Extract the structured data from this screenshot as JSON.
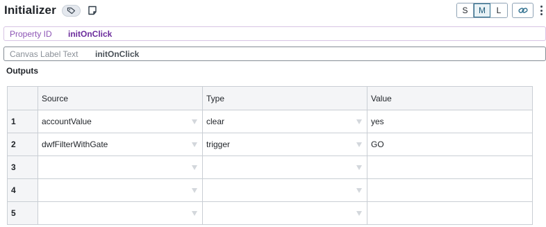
{
  "header": {
    "title": "Initializer",
    "tag_icon": "tag-icon",
    "edit_icon": "edit-note-icon"
  },
  "size_toggle": {
    "options": [
      "S",
      "M",
      "L"
    ],
    "selected": "M"
  },
  "toolbar": {
    "link_icon": "link-icon",
    "more_icon": "more-vertical-icon"
  },
  "property_id": {
    "label": "Property ID",
    "value": "initOnClick"
  },
  "canvas_label": {
    "label": "Canvas Label Text",
    "value": "initOnClick"
  },
  "outputs": {
    "label": "Outputs",
    "columns": [
      "",
      "Source",
      "Type",
      "Value"
    ],
    "rows": [
      {
        "num": "1",
        "source": "accountValue",
        "type": "clear",
        "value": "yes"
      },
      {
        "num": "2",
        "source": "dwfFilterWithGate",
        "type": "trigger",
        "value": "GO"
      },
      {
        "num": "3",
        "source": "",
        "type": "",
        "value": ""
      },
      {
        "num": "4",
        "source": "",
        "type": "",
        "value": ""
      },
      {
        "num": "5",
        "source": "",
        "type": "",
        "value": ""
      }
    ]
  },
  "colors": {
    "accent_purple": "#6b2c9c",
    "selected_size": "#2e6f8e"
  }
}
